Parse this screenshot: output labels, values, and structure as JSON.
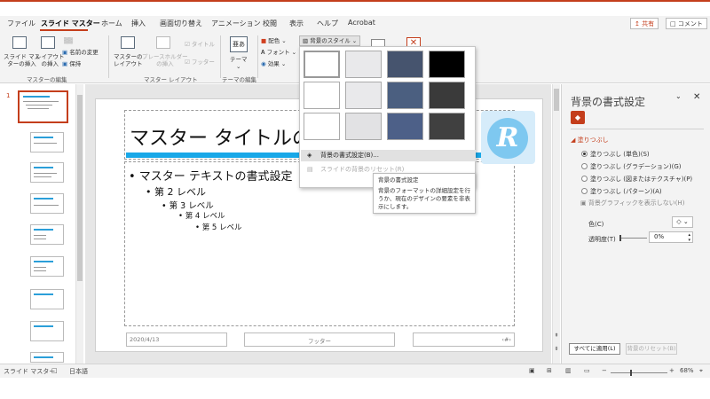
{
  "app": {
    "accent": "#c43e1c"
  },
  "tabs": [
    "ファイル",
    "スライド マスター",
    "ホーム",
    "挿入",
    "画面切り替え",
    "アニメーション",
    "校閲",
    "表示",
    "ヘルプ",
    "Acrobat"
  ],
  "active_tab": "スライド マスター",
  "share_button": "共有",
  "comment_button": "コメント",
  "ribbon": {
    "insert_master_l1": "スライド マス",
    "insert_master_l2": "ターの挿入",
    "insert_layout_l1": "レイアウト",
    "insert_layout_l2": "の挿入",
    "rename": "名前の変更",
    "preserve": "保持",
    "group_edit_master": "マスターの編集",
    "master_layout_l1": "マスターの",
    "master_layout_l2": "レイアウト",
    "placeholder_l1": "プレースホルダー",
    "placeholder_l2": "の挿入",
    "title_check": "タイトル",
    "footer_check": "フッター",
    "group_master_layout": "マスター レイアウト",
    "themes": "テーマ",
    "group_edit_theme": "テーマの編集",
    "colors": "配色",
    "fonts": "フォント",
    "effects": "効果",
    "bg_styles": "背景のスタイル"
  },
  "dropdown": {
    "swatches": [
      "#ffffff",
      "#e9e9eb",
      "#46546e",
      "#000000",
      "#ffffff",
      "#e9e9eb",
      "#4b5f80",
      "#3a3a3a",
      "#ffffff",
      "#e2e2e4",
      "#4d6088",
      "#404040"
    ],
    "format_bg": "背景の書式設定(B)...",
    "reset_bg": "スライドの背景のリセット(R)"
  },
  "tooltip": {
    "title": "背景の書式設定",
    "body": "背景のフォーマットの詳細設定を行うか、現在のデザインの要素を非表示にします。"
  },
  "thumbs": {
    "number": "1"
  },
  "slide": {
    "title": "マスター タイトルの書",
    "levels": [
      "• マスター テキストの書式設定",
      "• 第 2 レベル",
      "• 第 3 レベル",
      "• 第 4 レベル",
      "• 第 5 レベル"
    ],
    "date": "2020/4/13",
    "footer": "フッター",
    "page": "‹#›",
    "logo_letter": "R"
  },
  "format_pane": {
    "title": "背景の書式設定",
    "section": "塗りつぶし",
    "options": [
      "塗りつぶし (単色)(S)",
      "塗りつぶし (グラデーション)(G)",
      "塗りつぶし (図またはテクスチャ)(P)",
      "塗りつぶし (パターン)(A)"
    ],
    "hide_graphics": "背景グラフィックを表示しない(H)",
    "color_label": "色(C)",
    "transparency_label": "透明度(T)",
    "transparency_value": "0%",
    "apply_all": "すべてに適用(L)",
    "reset": "背景のリセット(B)"
  },
  "status": {
    "mode": "スライド マスター",
    "language": "日本語",
    "zoom": "68%"
  }
}
